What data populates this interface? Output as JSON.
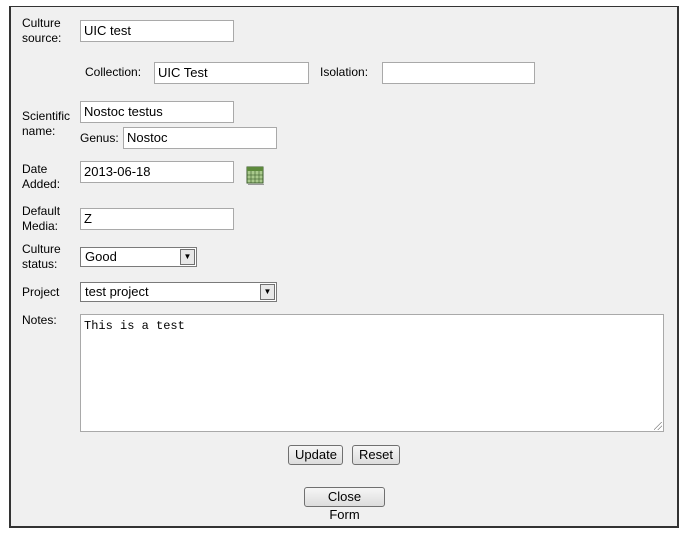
{
  "form": {
    "culture_source_label": "Culture source:",
    "culture_source_value": "UIC test",
    "collection_label": "Collection:",
    "collection_value": "UIC Test",
    "isolation_label": "Isolation:",
    "isolation_value": "",
    "scientific_name_label": "Scientific name:",
    "scientific_name_value": "Nostoc testus",
    "genus_label": "Genus:",
    "genus_value": "Nostoc",
    "date_added_label": "Date Added:",
    "date_added_value": "2013-06-18",
    "calendar_icon": "calendar-icon",
    "default_media_label": "Default Media:",
    "default_media_value": "Z",
    "culture_status_label": "Culture status:",
    "culture_status_value": "Good",
    "project_label": "Project",
    "project_value": "test project",
    "notes_label": "Notes:",
    "notes_value": "This is a test"
  },
  "buttons": {
    "update": "Update",
    "reset": "Reset",
    "close_form": "Close Form"
  },
  "colors": {
    "panel_background": "#f0f0f0",
    "frame_border": "#333333"
  }
}
